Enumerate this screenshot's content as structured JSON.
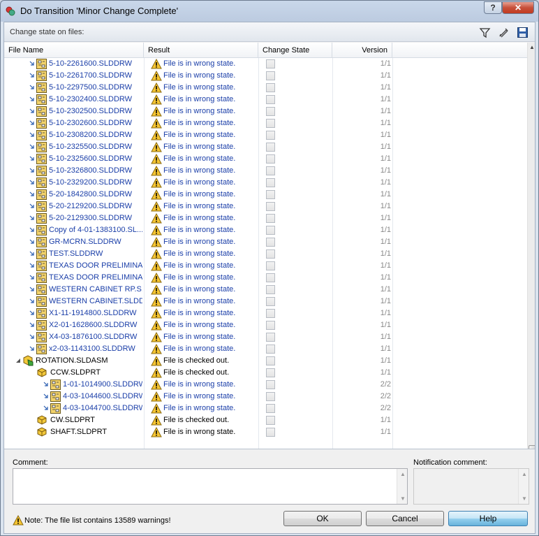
{
  "window": {
    "title": "Do Transition 'Minor Change Complete'",
    "help_glyph": "?",
    "close_glyph": "✕"
  },
  "header": {
    "label": "Change state on files:",
    "icons": [
      "filter-icon",
      "edit-columns-icon",
      "save-icon"
    ]
  },
  "columns": [
    "File Name",
    "Result",
    "Change State",
    "Version"
  ],
  "rows": [
    {
      "name": "5-10-2261600.SLDDRW",
      "result": "File is in wrong state.",
      "version": "1/1",
      "level": 0,
      "kind": "drw",
      "result_color": "blue"
    },
    {
      "name": "5-10-2261700.SLDDRW",
      "result": "File is in wrong state.",
      "version": "1/1",
      "level": 0,
      "kind": "drw",
      "result_color": "blue"
    },
    {
      "name": "5-10-2297500.SLDDRW",
      "result": "File is in wrong state.",
      "version": "1/1",
      "level": 0,
      "kind": "drw",
      "result_color": "blue"
    },
    {
      "name": "5-10-2302400.SLDDRW",
      "result": "File is in wrong state.",
      "version": "1/1",
      "level": 0,
      "kind": "drw",
      "result_color": "blue"
    },
    {
      "name": "5-10-2302500.SLDDRW",
      "result": "File is in wrong state.",
      "version": "1/1",
      "level": 0,
      "kind": "drw",
      "result_color": "blue"
    },
    {
      "name": "5-10-2302600.SLDDRW",
      "result": "File is in wrong state.",
      "version": "1/1",
      "level": 0,
      "kind": "drw",
      "result_color": "blue"
    },
    {
      "name": "5-10-2308200.SLDDRW",
      "result": "File is in wrong state.",
      "version": "1/1",
      "level": 0,
      "kind": "drw",
      "result_color": "blue"
    },
    {
      "name": "5-10-2325500.SLDDRW",
      "result": "File is in wrong state.",
      "version": "1/1",
      "level": 0,
      "kind": "drw",
      "result_color": "blue"
    },
    {
      "name": "5-10-2325600.SLDDRW",
      "result": "File is in wrong state.",
      "version": "1/1",
      "level": 0,
      "kind": "drw",
      "result_color": "blue"
    },
    {
      "name": "5-10-2326800.SLDDRW",
      "result": "File is in wrong state.",
      "version": "1/1",
      "level": 0,
      "kind": "drw",
      "result_color": "blue"
    },
    {
      "name": "5-10-2329200.SLDDRW",
      "result": "File is in wrong state.",
      "version": "1/1",
      "level": 0,
      "kind": "drw",
      "result_color": "blue"
    },
    {
      "name": "5-20-1842800.SLDDRW",
      "result": "File is in wrong state.",
      "version": "1/1",
      "level": 0,
      "kind": "drw",
      "result_color": "blue"
    },
    {
      "name": "5-20-2129200.SLDDRW",
      "result": "File is in wrong state.",
      "version": "1/1",
      "level": 0,
      "kind": "drw",
      "result_color": "blue"
    },
    {
      "name": "5-20-2129300.SLDDRW",
      "result": "File is in wrong state.",
      "version": "1/1",
      "level": 0,
      "kind": "drw",
      "result_color": "blue"
    },
    {
      "name": "Copy of 4-01-1383100.SL...",
      "result": "File is in wrong state.",
      "version": "1/1",
      "level": 0,
      "kind": "drw",
      "result_color": "blue"
    },
    {
      "name": "GR-MCRN.SLDDRW",
      "result": "File is in wrong state.",
      "version": "1/1",
      "level": 0,
      "kind": "drw",
      "result_color": "blue"
    },
    {
      "name": "TEST.SLDDRW",
      "result": "File is in wrong state.",
      "version": "1/1",
      "level": 0,
      "kind": "drw",
      "result_color": "blue"
    },
    {
      "name": "TEXAS DOOR PRELIMINA...",
      "result": "File is in wrong state.",
      "version": "1/1",
      "level": 0,
      "kind": "drw",
      "result_color": "blue"
    },
    {
      "name": "TEXAS DOOR PRELIMINA...",
      "result": "File is in wrong state.",
      "version": "1/1",
      "level": 0,
      "kind": "drw",
      "result_color": "blue"
    },
    {
      "name": "WESTERN CABINET RP.S...",
      "result": "File is in wrong state.",
      "version": "1/1",
      "level": 0,
      "kind": "drw",
      "result_color": "blue"
    },
    {
      "name": "WESTERN CABINET.SLDD...",
      "result": "File is in wrong state.",
      "version": "1/1",
      "level": 0,
      "kind": "drw",
      "result_color": "blue"
    },
    {
      "name": "X1-11-1914800.SLDDRW",
      "result": "File is in wrong state.",
      "version": "1/1",
      "level": 0,
      "kind": "drw",
      "result_color": "blue"
    },
    {
      "name": "X2-01-1628600.SLDDRW",
      "result": "File is in wrong state.",
      "version": "1/1",
      "level": 0,
      "kind": "drw",
      "result_color": "blue"
    },
    {
      "name": "X4-03-1876100.SLDDRW",
      "result": "File is in wrong state.",
      "version": "1/1",
      "level": 0,
      "kind": "drw",
      "result_color": "blue"
    },
    {
      "name": "x2-03-1143100.SLDDRW",
      "result": "File is in wrong state.",
      "version": "1/1",
      "level": 0,
      "kind": "drw",
      "result_color": "blue"
    },
    {
      "name": "ROTATION.SLDASM",
      "result": "File is checked out.",
      "version": "1/1",
      "level": -1,
      "kind": "asm",
      "result_color": "black"
    },
    {
      "name": "CCW.SLDPRT",
      "result": "File is checked out.",
      "version": "1/1",
      "level": 1,
      "kind": "prt",
      "result_color": "black"
    },
    {
      "name": "1-01-1014900.SLDDRW",
      "result": "File is in wrong state.",
      "version": "2/2",
      "level": 2,
      "kind": "drw",
      "result_color": "blue"
    },
    {
      "name": "4-03-1044600.SLDDRW",
      "result": "File is in wrong state.",
      "version": "2/2",
      "level": 2,
      "kind": "drw",
      "result_color": "blue"
    },
    {
      "name": "4-03-1044700.SLDDRW",
      "result": "File is in wrong state.",
      "version": "2/2",
      "level": 2,
      "kind": "drw",
      "result_color": "blue"
    },
    {
      "name": "CW.SLDPRT",
      "result": "File is checked out.",
      "version": "1/1",
      "level": 1,
      "kind": "prt",
      "result_color": "black"
    },
    {
      "name": "SHAFT.SLDPRT",
      "result": "File is in wrong state.",
      "version": "1/1",
      "level": 1,
      "kind": "prt",
      "result_color": "black"
    }
  ],
  "comment": {
    "label": "Comment:",
    "value": ""
  },
  "notification": {
    "label": "Notification comment:",
    "value": ""
  },
  "note": "Note: The file list contains 13589 warnings!",
  "buttons": {
    "ok": "OK",
    "cancel": "Cancel",
    "help": "Help"
  }
}
